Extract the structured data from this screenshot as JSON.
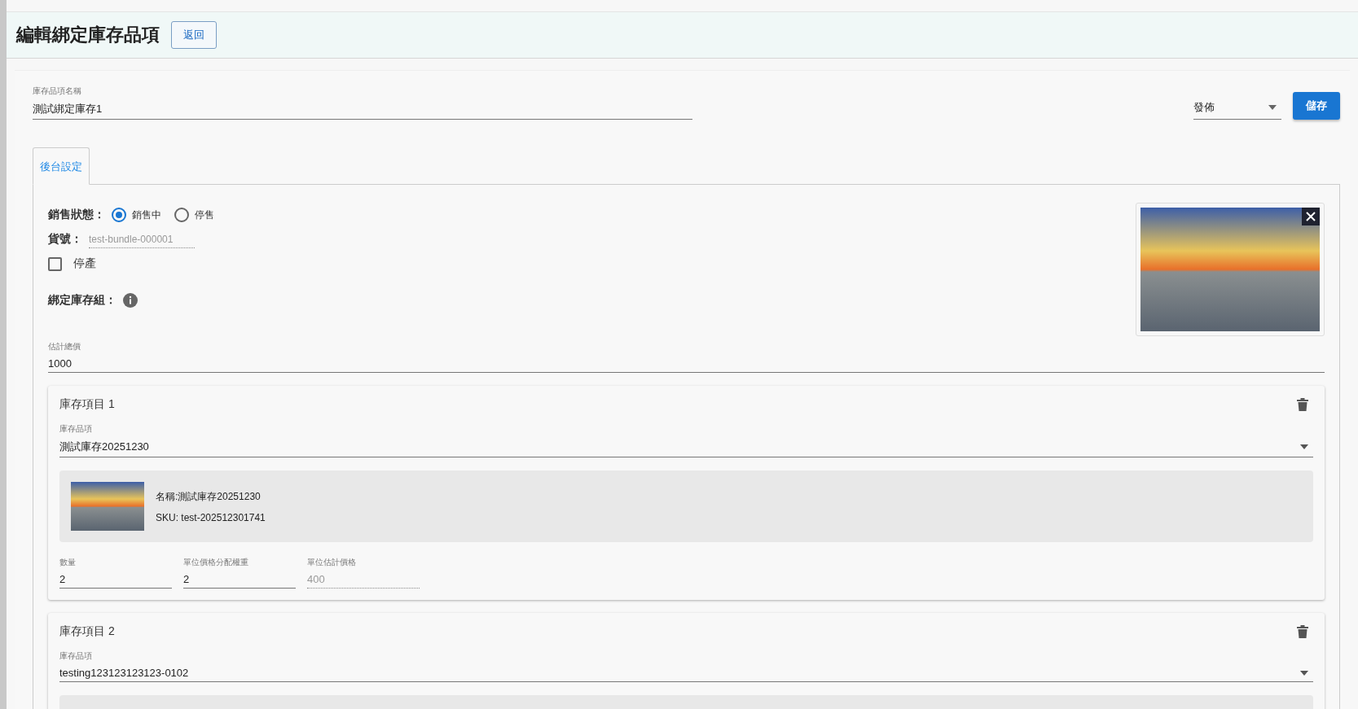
{
  "header": {
    "title": "編輯綁定庫存品項",
    "back_button": "返回"
  },
  "name_field": {
    "label": "庫存品項名稱",
    "value": "測試綁定庫存1"
  },
  "status_select": {
    "value": "發佈"
  },
  "save_button": "儲存",
  "tabs": [
    {
      "label": "後台設定",
      "selected": true
    }
  ],
  "sale_status": {
    "label": "銷售狀態：",
    "options": [
      {
        "label": "銷售中",
        "selected": true
      },
      {
        "label": "停售",
        "selected": false
      }
    ]
  },
  "sku": {
    "label": "貨號：",
    "value": "test-bundle-000001"
  },
  "discontinued": {
    "label": "停產",
    "checked": false
  },
  "bundle_group": {
    "label": "綁定庫存組："
  },
  "total_field": {
    "label": "估計總價",
    "value": "1000"
  },
  "items": [
    {
      "title": "庫存項目 1",
      "select_label": "庫存品項",
      "select_value": "測試庫存20251230",
      "name": "名稱:測試庫存20251230",
      "sku": "SKU: test-202512301741",
      "fields": [
        {
          "label": "數量",
          "value": "2",
          "disabled": false
        },
        {
          "label": "單位價格分配權重",
          "value": "2",
          "disabled": false
        },
        {
          "label": "單位估計價格",
          "value": "400",
          "disabled": true
        }
      ]
    },
    {
      "title": "庫存項目 2",
      "select_label": "庫存品項",
      "select_value": "testing123123123123-0102"
    }
  ]
}
